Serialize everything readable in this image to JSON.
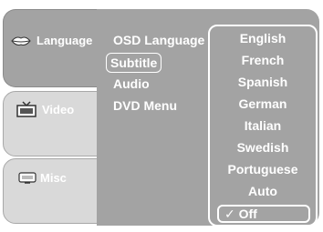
{
  "tabs": [
    {
      "label": "Language",
      "icon": "lips-icon"
    },
    {
      "label": "Video",
      "icon": "tv-icon"
    },
    {
      "label": "Misc",
      "icon": "monitor-icon"
    }
  ],
  "menu": [
    {
      "label": "OSD Language"
    },
    {
      "label": "Subtitle"
    },
    {
      "label": "Audio"
    },
    {
      "label": "DVD Menu"
    }
  ],
  "options": [
    {
      "label": "English"
    },
    {
      "label": "French"
    },
    {
      "label": "Spanish"
    },
    {
      "label": "German"
    },
    {
      "label": "Italian"
    },
    {
      "label": "Swedish"
    },
    {
      "label": "Portuguese"
    },
    {
      "label": "Auto"
    },
    {
      "label": "Off"
    }
  ],
  "selected_option": {
    "check": "✓",
    "label": "Off"
  },
  "colors": {
    "panel": "#a3a3a3",
    "inactive_tab": "#d9d9d9",
    "text": "#ffffff"
  }
}
